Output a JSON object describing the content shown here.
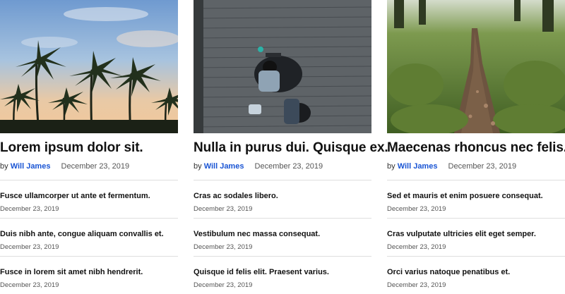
{
  "cards": [
    {
      "image": "palm-trees-sunset",
      "title": "Lorem ipsum dolor sit.",
      "by": "by",
      "author": "Will James",
      "date": "December 23, 2019",
      "items": [
        {
          "title": "Fusce ullamcorper ut ante et fermentum.",
          "date": "December 23, 2019"
        },
        {
          "title": "Duis nibh ante, congue aliquam convallis et.",
          "date": "December 23, 2019"
        },
        {
          "title": "Fusce in lorem sit amet nibh hendrerit.",
          "date": "December 23, 2019"
        }
      ]
    },
    {
      "image": "people-on-boardwalk",
      "title": "Nulla in purus dui. Quisque ex.",
      "by": "by",
      "author": "Will James",
      "date": "December 23, 2019",
      "items": [
        {
          "title": "Cras ac sodales libero.",
          "date": "December 23, 2019"
        },
        {
          "title": "Vestibulum nec massa consequat.",
          "date": "December 23, 2019"
        },
        {
          "title": "Quisque id felis elit. Praesent varius.",
          "date": "December 23, 2019"
        }
      ]
    },
    {
      "image": "forest-path",
      "title": "Maecenas rhoncus nec felis.",
      "by": "by",
      "author": "Will James",
      "date": "December 23, 2019",
      "items": [
        {
          "title": "Sed et mauris et enim posuere consequat.",
          "date": "December 23, 2019"
        },
        {
          "title": "Cras vulputate ultricies elit eget semper.",
          "date": "December 23, 2019"
        },
        {
          "title": "Orci varius natoque penatibus et.",
          "date": "December 23, 2019"
        }
      ]
    }
  ]
}
